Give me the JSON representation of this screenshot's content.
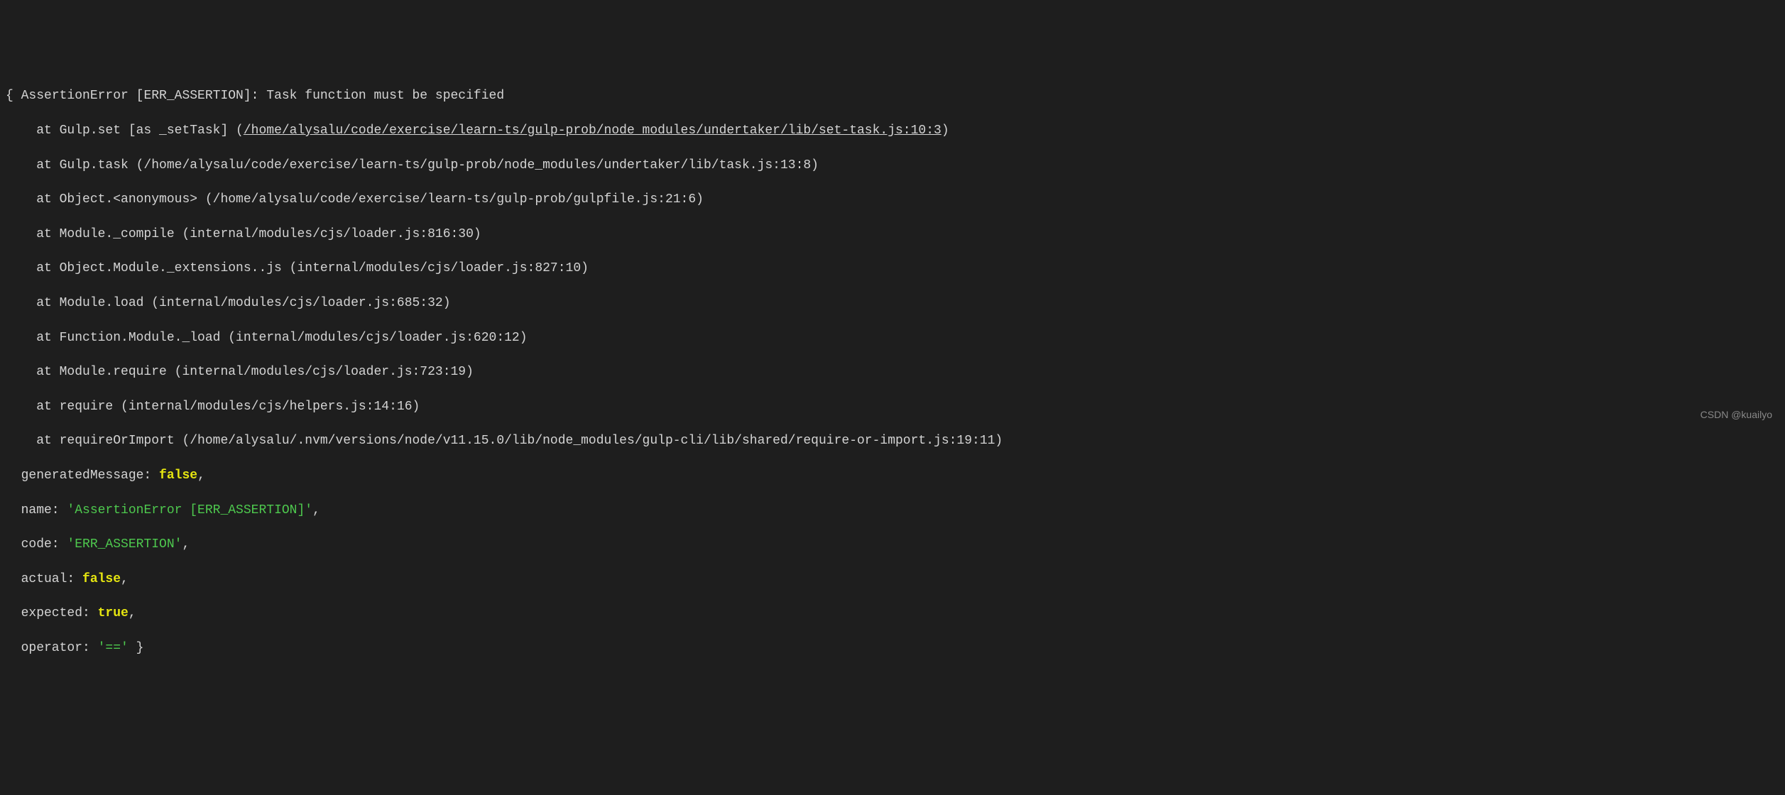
{
  "error": {
    "header_prefix": "{ ",
    "header_text": "AssertionError [ERR_ASSERTION]: Task function must be specified",
    "stack": [
      {
        "at": "    at Gulp.set [as _setTask] (",
        "path": "/home/alysalu/code/exercise/learn-ts/gulp-prob/node_modules/undertaker/lib/set-task.js:10:3",
        "close": ")",
        "underline": true
      },
      {
        "at": "    at Gulp.task (/home/alysalu/code/exercise/learn-ts/gulp-prob/node_modules/undertaker/lib/task.js:13:8)",
        "path": "",
        "close": "",
        "underline": false
      },
      {
        "at": "    at Object.<anonymous> (/home/alysalu/code/exercise/learn-ts/gulp-prob/gulpfile.js:21:6)",
        "path": "",
        "close": "",
        "underline": false
      },
      {
        "at": "    at Module._compile (internal/modules/cjs/loader.js:816:30)",
        "path": "",
        "close": "",
        "underline": false
      },
      {
        "at": "    at Object.Module._extensions..js (internal/modules/cjs/loader.js:827:10)",
        "path": "",
        "close": "",
        "underline": false
      },
      {
        "at": "    at Module.load (internal/modules/cjs/loader.js:685:32)",
        "path": "",
        "close": "",
        "underline": false
      },
      {
        "at": "    at Function.Module._load (internal/modules/cjs/loader.js:620:12)",
        "path": "",
        "close": "",
        "underline": false
      },
      {
        "at": "    at Module.require (internal/modules/cjs/loader.js:723:19)",
        "path": "",
        "close": "",
        "underline": false
      },
      {
        "at": "    at require (internal/modules/cjs/helpers.js:14:16)",
        "path": "",
        "close": "",
        "underline": false
      },
      {
        "at": "    at requireOrImport (/home/alysalu/.nvm/versions/node/v11.15.0/lib/node_modules/gulp-cli/lib/shared/require-or-import.js:19:11)",
        "path": "",
        "close": "",
        "underline": false
      }
    ],
    "props": {
      "generatedMessage_key": "  generatedMessage: ",
      "generatedMessage_val": "false",
      "name_key": "  name: ",
      "name_val": "'AssertionError [ERR_ASSERTION]'",
      "code_key": "  code: ",
      "code_val": "'ERR_ASSERTION'",
      "actual_key": "  actual: ",
      "actual_val": "false",
      "expected_key": "  expected: ",
      "expected_val": "true",
      "operator_key": "  operator: ",
      "operator_val": "'=='",
      "close_brace": " }"
    }
  },
  "watermark": "CSDN @kuailyo"
}
